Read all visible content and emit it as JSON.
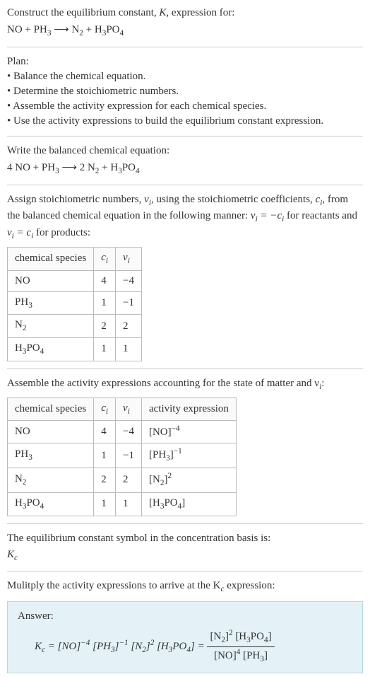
{
  "intro": {
    "line1": "Construct the equilibrium constant, ",
    "K": "K",
    "line1b": ", expression for:",
    "eq_unbalanced_html": "NO + PH<span class='sub'>3</span> <span class='arrow'>⟶</span> N<span class='sub'>2</span> + H<span class='sub'>3</span>PO<span class='sub'>4</span>"
  },
  "plan": {
    "heading": "Plan:",
    "b1": "• Balance the chemical equation.",
    "b2": "• Determine the stoichiometric numbers.",
    "b3": "• Assemble the activity expression for each chemical species.",
    "b4": "• Use the activity expressions to build the equilibrium constant expression."
  },
  "balanced": {
    "heading": "Write the balanced chemical equation:",
    "eq_html": "4 NO + PH<span class='sub'>3</span> <span class='arrow'>⟶</span> 2 N<span class='sub'>2</span> + H<span class='sub'>3</span>PO<span class='sub'>4</span>"
  },
  "stoich": {
    "text_a": "Assign stoichiometric numbers, ",
    "nu_i": "ν",
    "text_b": ", using the stoichiometric coefficients, ",
    "c_i": "c",
    "text_c": ", from the balanced chemical equation in the following manner: ",
    "rel1_html": "ν<span class='sub italic'>i</span> = −c<span class='sub italic'>i</span>",
    "text_d": " for reactants and ",
    "rel2_html": "ν<span class='sub italic'>i</span> = c<span class='sub italic'>i</span>",
    "text_e": " for products:"
  },
  "table1": {
    "h1": "chemical species",
    "h2_html": "c<span class='sub italic'>i</span>",
    "h3_html": "ν<span class='sub italic'>i</span>",
    "rows": [
      {
        "sp_html": "NO",
        "c": "4",
        "nu": "−4"
      },
      {
        "sp_html": "PH<span class='sub'>3</span>",
        "c": "1",
        "nu": "−1"
      },
      {
        "sp_html": "N<span class='sub'>2</span>",
        "c": "2",
        "nu": "2"
      },
      {
        "sp_html": "H<span class='sub'>3</span>PO<span class='sub'>4</span>",
        "c": "1",
        "nu": "1"
      }
    ]
  },
  "activity": {
    "text_html": "Assemble the activity expressions accounting for the state of matter and ν<span class='sub italic'>i</span>:"
  },
  "table2": {
    "h1": "chemical species",
    "h2_html": "c<span class='sub italic'>i</span>",
    "h3_html": "ν<span class='sub italic'>i</span>",
    "h4": "activity expression",
    "rows": [
      {
        "sp_html": "NO",
        "c": "4",
        "nu": "−4",
        "act_html": "[NO]<span class='sup'>−4</span>"
      },
      {
        "sp_html": "PH<span class='sub'>3</span>",
        "c": "1",
        "nu": "−1",
        "act_html": "[PH<span class='sub'>3</span>]<span class='sup'>−1</span>"
      },
      {
        "sp_html": "N<span class='sub'>2</span>",
        "c": "2",
        "nu": "2",
        "act_html": "[N<span class='sub'>2</span>]<span class='sup'>2</span>"
      },
      {
        "sp_html": "H<span class='sub'>3</span>PO<span class='sub'>4</span>",
        "c": "1",
        "nu": "1",
        "act_html": "[H<span class='sub'>3</span>PO<span class='sub'>4</span>]"
      }
    ]
  },
  "symbol": {
    "line1": "The equilibrium constant symbol in the concentration basis is:",
    "kc_html": "K<span class='sub italic'>c</span>"
  },
  "mult": {
    "text_html": "Mulitply the activity expressions to arrive at the K<span class='sub italic'>c</span> expression:"
  },
  "answer": {
    "label": "Answer:",
    "lhs_html": "K<span class='sub italic'>c</span> = [NO]<span class='sup'>−4</span> [PH<span class='sub'>3</span>]<span class='sup'>−1</span> [N<span class='sub'>2</span>]<span class='sup'>2</span> [H<span class='sub'>3</span>PO<span class='sub'>4</span>] = ",
    "num_html": "[N<span class='sub'>2</span>]<span class='sup'>2</span> [H<span class='sub'>3</span>PO<span class='sub'>4</span>]",
    "den_html": "[NO]<span class='sup'>4</span> [PH<span class='sub'>3</span>]"
  }
}
